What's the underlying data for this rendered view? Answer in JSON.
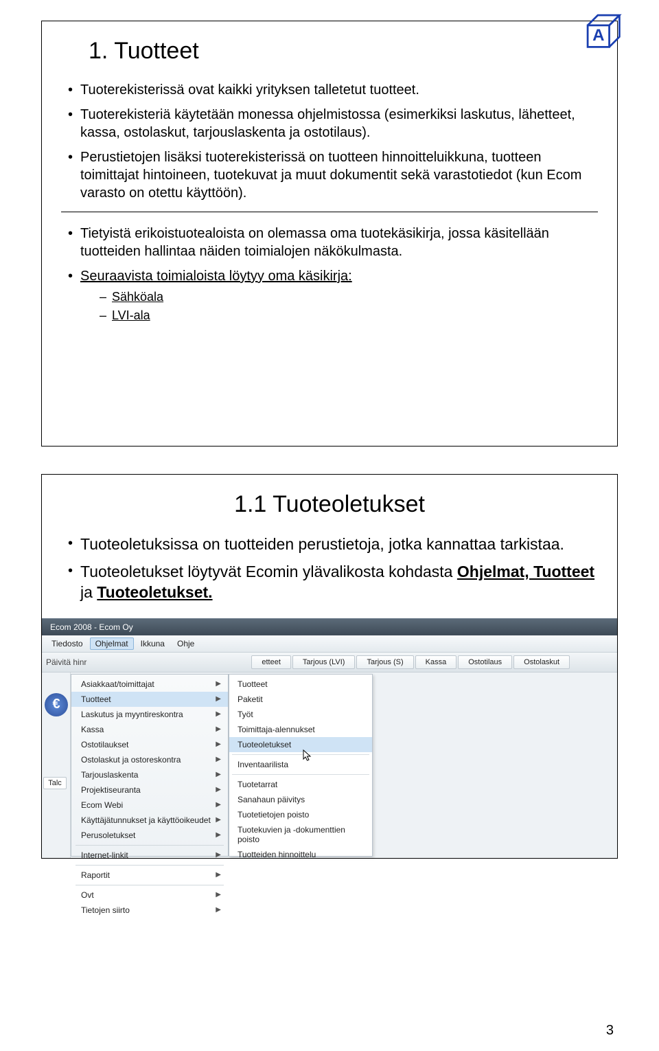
{
  "slide1": {
    "title": "1. Tuotteet",
    "bullets": [
      "Tuoterekisterissä ovat kaikki yrityksen talletetut tuotteet.",
      "Tuoterekisteriä käytetään monessa ohjelmistossa (esimerkiksi laskutus, lähetteet, kassa, ostolaskut, tarjouslaskenta ja ostotilaus).",
      "Perustietojen lisäksi tuoterekisterissä on tuotteen hinnoitteluikkuna, tuotteen toimittajat hintoineen, tuotekuvat ja muut dokumentit sekä varastotiedot (kun Ecom varasto on otettu käyttöön)."
    ],
    "bullets2": [
      "Tietyistä erikoistuotealoista on olemassa oma tuotekäsikirja, jossa käsitellään tuotteiden hallintaa näiden toimialojen näkökulmasta."
    ],
    "linkline": "Seuraavista toimialoista löytyy oma käsikirja:",
    "subs": [
      "Sähköala",
      "LVI-ala"
    ]
  },
  "slide2": {
    "title": "1.1 Tuoteoletukset",
    "bullets": [
      "Tuoteoletuksissa on tuotteiden perustietoja, jotka kannattaa tarkistaa."
    ],
    "bullets_rich": {
      "pre": "Tuoteoletukset löytyvät Ecomin ylävalikosta kohdasta ",
      "u1": "Ohjelmat, Tuotteet",
      "mid": " ja ",
      "u2": "Tuoteoletukset."
    }
  },
  "app": {
    "title": "Ecom 2008 - Ecom Oy",
    "menubar": [
      "Tiedosto",
      "Ohjelmat",
      "Ikkuna",
      "Ohje"
    ],
    "toolbar_label": "Päivitä hinr",
    "toolbar_buttons": [
      "etteet",
      "Tarjous (LVI)",
      "Tarjous (S)",
      "Kassa",
      "Ostotilaus",
      "Ostolaskut"
    ],
    "mainmenu": [
      "Asiakkaat/toimittajat",
      "Tuotteet",
      "Laskutus ja myyntireskontra",
      "Kassa",
      "Ostotilaukset",
      "Ostolaskut ja ostoreskontra",
      "Tarjouslaskenta",
      "Projektiseuranta",
      "Ecom Webi",
      "Käyttäjätunnukset ja käyttöoikeudet",
      "Perusoletukset",
      "Internet-linkit",
      "Raportit",
      "Ovt",
      "Tietojen siirto"
    ],
    "mainmenu_hl_index": 1,
    "mainmenu_sep_after": [
      10,
      11,
      12
    ],
    "submenu": [
      "Tuotteet",
      "Paketit",
      "Työt",
      "Toimittaja-alennukset",
      "Tuoteoletukset",
      "Inventaarilista",
      "Tuotetarrat",
      "Sanahaun päivitys",
      "Tuotetietojen poisto",
      "Tuotekuvien ja -dokumenttien poisto",
      "Tuotteiden hinnoittelu"
    ],
    "submenu_hl_index": 4,
    "submenu_sep_after": [
      4,
      5
    ],
    "leftlabel": "Talc",
    "euro": "€"
  },
  "pagenum": "3"
}
